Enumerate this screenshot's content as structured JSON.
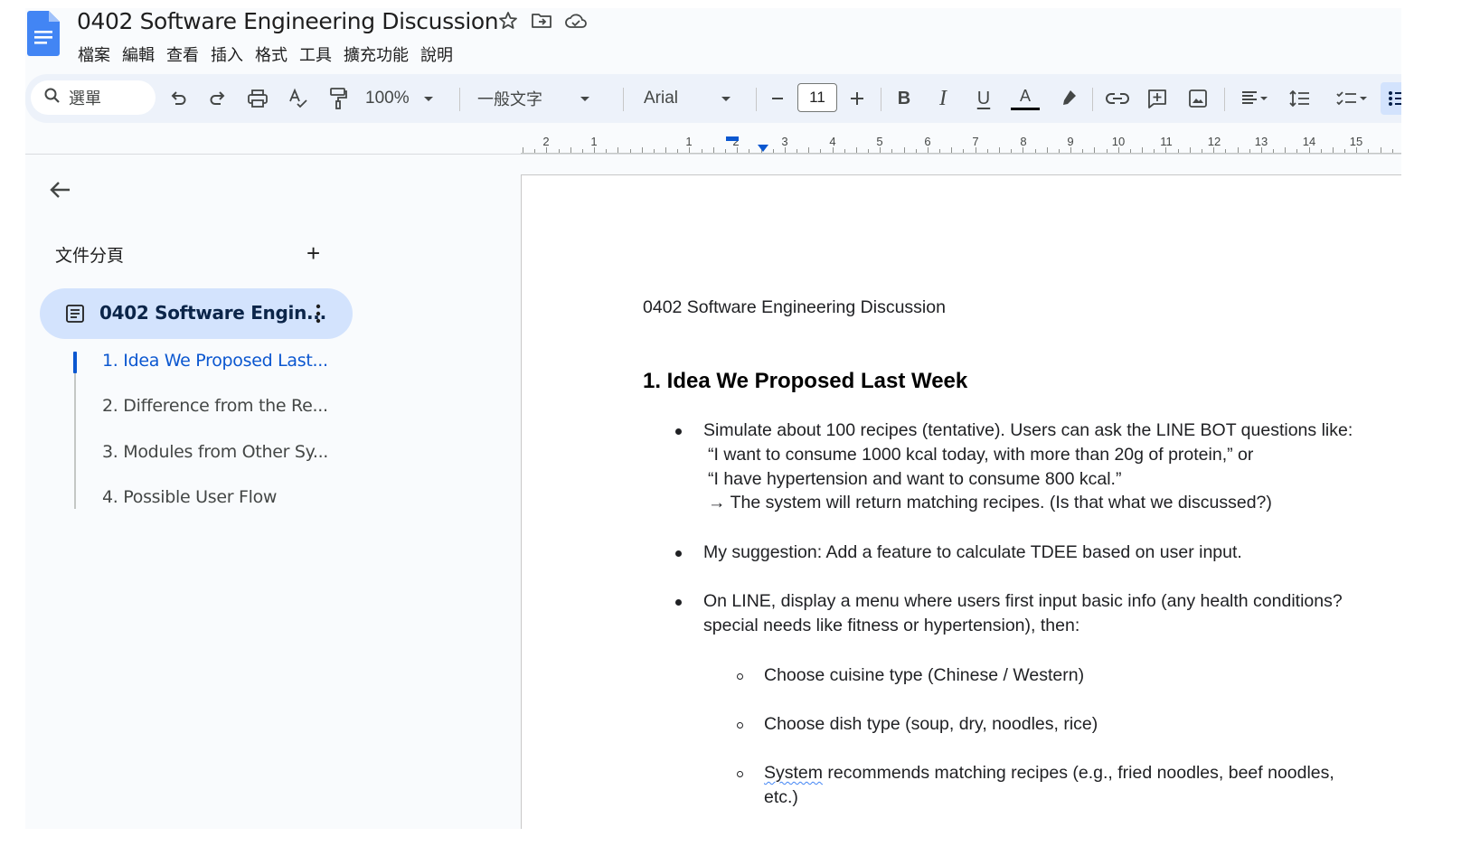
{
  "header": {
    "title": "0402 Software Engineering Discussion",
    "menus": [
      "檔案",
      "編輯",
      "查看",
      "插入",
      "格式",
      "工具",
      "擴充功能",
      "說明"
    ]
  },
  "toolbar": {
    "search_label": "選單",
    "zoom": "100%",
    "style": "一般文字",
    "font": "Arial",
    "font_size": "11",
    "bold": "B",
    "italic": "I",
    "underline": "U",
    "text_color": "A"
  },
  "ruler": {
    "labels": [
      "2",
      "1",
      "1",
      "2",
      "3",
      "4",
      "5",
      "6",
      "7",
      "8",
      "9",
      "10",
      "11",
      "12",
      "13",
      "14",
      "15"
    ]
  },
  "sidebar": {
    "tabs_title": "文件分頁",
    "add": "+",
    "tab_label": "0402 Software Engin...",
    "outline": [
      "1. Idea We Proposed Last...",
      "2. Difference from the Re...",
      "3. Modules from Other Sy...",
      "4. Possible User Flow"
    ]
  },
  "document": {
    "subtitle": "0402 Software Engineering Discussion",
    "heading": "1. Idea We Proposed Last Week",
    "bullet1": [
      "Simulate about 100 recipes (tentative). Users can ask the LINE BOT questions like:",
      "“I want to consume 1000 kcal today, with more than 20g of protein,” or",
      "“I have hypertension and want to consume 800 kcal.”",
      "→ The system will return matching recipes. (Is that what we discussed?)"
    ],
    "bullet2": "My suggestion: Add a feature to calculate TDEE based on user input.",
    "bullet3": [
      "On LINE, display a menu where users first input basic info (any health conditions?",
      "special needs like fitness or hypertension), then:"
    ],
    "sub1": "Choose cuisine type (Chinese / Western)",
    "sub2": "Choose dish type (soup, dry, noodles, rice)",
    "sub3_word": "System",
    "sub3_rest": " recommends matching recipes (e.g., fried noodles, beef noodles,",
    "sub3_line2": "etc.)"
  },
  "colors": {
    "accent": "#0b57d0",
    "toolbar_bg": "#edf2fa",
    "tab_bg": "#d3e3fd",
    "docs_blue": "#4285f4"
  }
}
